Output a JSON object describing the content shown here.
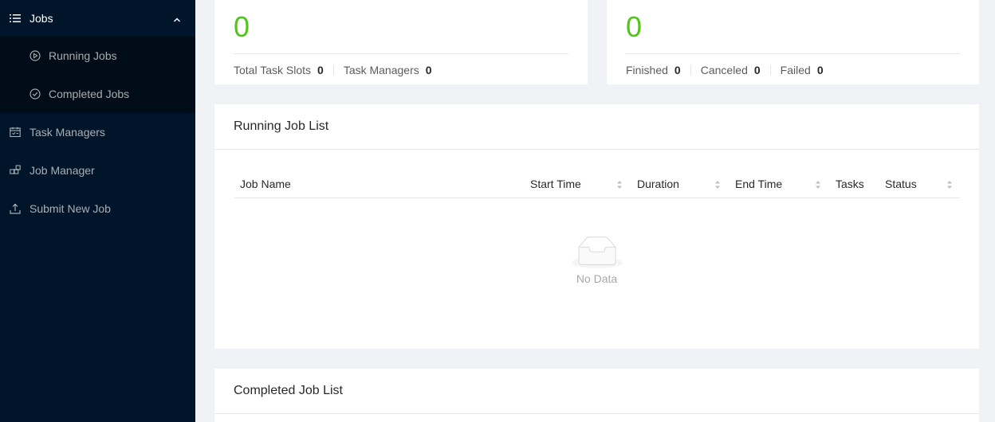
{
  "sidebar": {
    "jobs_label": "Jobs",
    "running_jobs_label": "Running Jobs",
    "completed_jobs_label": "Completed Jobs",
    "task_managers_label": "Task Managers",
    "job_manager_label": "Job Manager",
    "submit_new_job_label": "Submit New Job"
  },
  "task_stats": {
    "value": "0",
    "total_task_slots_label": "Total Task Slots",
    "total_task_slots_value": "0",
    "task_managers_label": "Task Managers",
    "task_managers_value": "0"
  },
  "job_stats": {
    "value": "0",
    "finished_label": "Finished",
    "finished_value": "0",
    "canceled_label": "Canceled",
    "canceled_value": "0",
    "failed_label": "Failed",
    "failed_value": "0"
  },
  "running_list": {
    "title": "Running Job List",
    "columns": {
      "job_name": "Job Name",
      "start_time": "Start Time",
      "duration": "Duration",
      "end_time": "End Time",
      "tasks": "Tasks",
      "status": "Status"
    },
    "empty_text": "No Data"
  },
  "completed_list": {
    "title": "Completed Job List"
  },
  "colors": {
    "sidebar_bg": "#001529",
    "submenu_bg": "#000c17",
    "stat_green": "#52c41a"
  }
}
